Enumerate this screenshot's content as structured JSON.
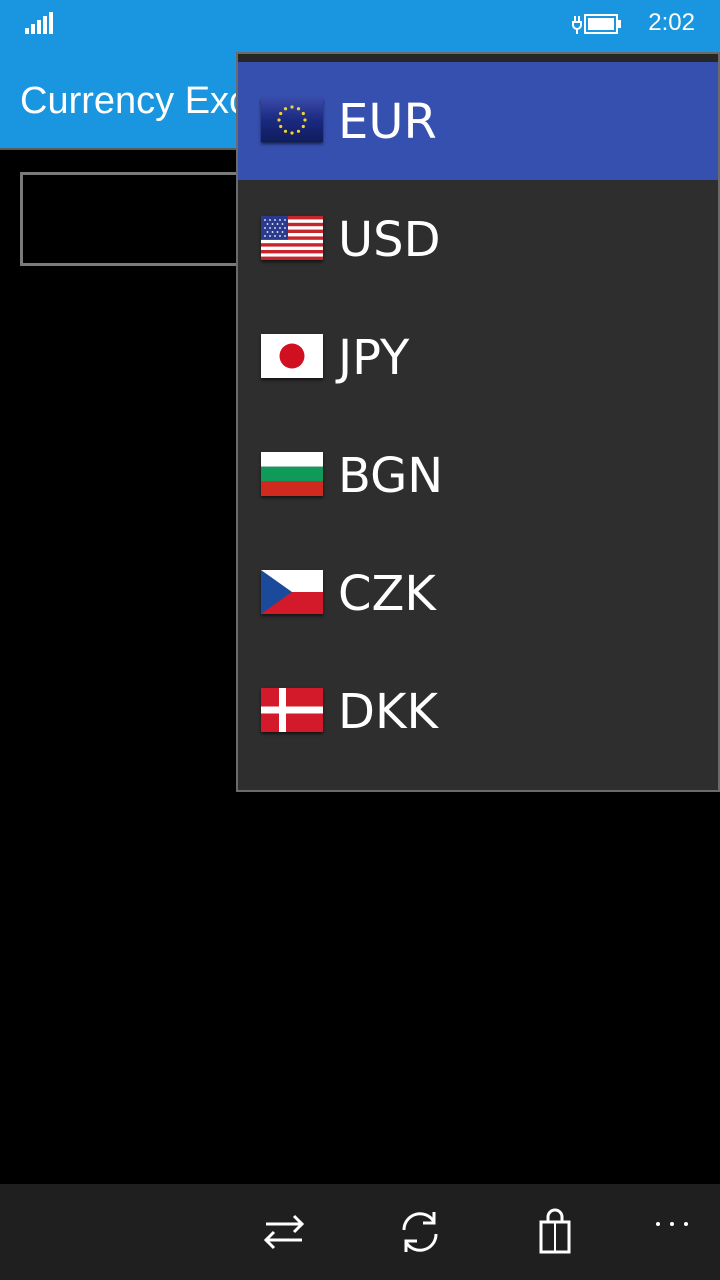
{
  "status_bar": {
    "time": "2:02",
    "signal_icon": "signal-strength-icon",
    "battery_icon": "battery-charging-icon"
  },
  "app": {
    "title": "Currency Exc"
  },
  "amount_input": {
    "value": ""
  },
  "currency_dropdown": {
    "selected": "EUR",
    "accent_color": "#3650b0",
    "options": [
      {
        "code": "EUR",
        "flag_icon": "eu-flag-icon"
      },
      {
        "code": "USD",
        "flag_icon": "us-flag-icon"
      },
      {
        "code": "JPY",
        "flag_icon": "japan-flag-icon"
      },
      {
        "code": "BGN",
        "flag_icon": "bulgaria-flag-icon"
      },
      {
        "code": "CZK",
        "flag_icon": "czech-flag-icon"
      },
      {
        "code": "DKK",
        "flag_icon": "denmark-flag-icon"
      }
    ]
  },
  "app_bar": {
    "buttons": [
      {
        "icon": "swap-icon"
      },
      {
        "icon": "refresh-icon"
      },
      {
        "icon": "store-bag-icon"
      },
      {
        "icon": "more-icon"
      }
    ]
  },
  "colors": {
    "header": "#1a96e0",
    "background": "#000000",
    "dropdown": "#2e2e2e",
    "app_bar": "#1f1f1f"
  }
}
